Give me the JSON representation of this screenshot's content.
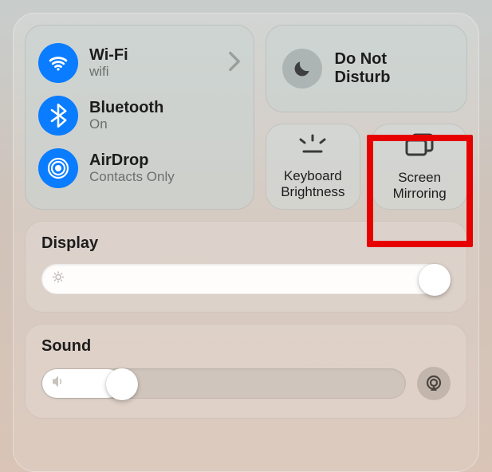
{
  "connectivity": {
    "wifi": {
      "label": "Wi-Fi",
      "sub": "wifi"
    },
    "bluetooth": {
      "label": "Bluetooth",
      "sub": "On"
    },
    "airdrop": {
      "label": "AirDrop",
      "sub": "Contacts Only"
    }
  },
  "dnd": {
    "label_l1": "Do Not",
    "label_l2": "Disturb"
  },
  "tiles": {
    "keyboard_brightness_l1": "Keyboard",
    "keyboard_brightness_l2": "Brightness",
    "screen_mirror_l1": "Screen",
    "screen_mirror_l2": "Mirroring"
  },
  "display": {
    "title": "Display",
    "value_pct": 100
  },
  "sound": {
    "title": "Sound",
    "value_pct": 18
  },
  "colors": {
    "accent_blue": "#0a7cff",
    "highlight_red": "#e60000"
  }
}
